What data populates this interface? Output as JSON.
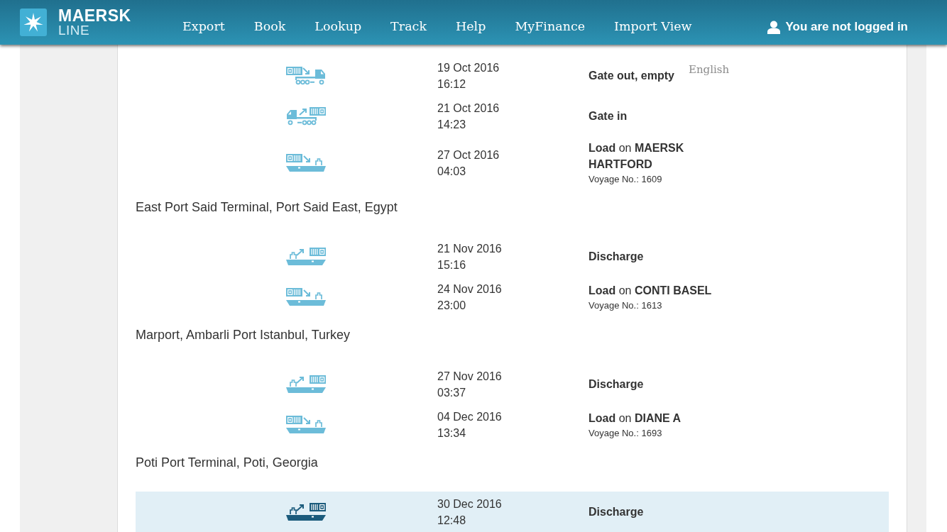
{
  "header": {
    "brand": {
      "name": "MAERSK",
      "subtitle": "LINE"
    },
    "nav": [
      "Export",
      "Book",
      "Lookup",
      "Track",
      "Help",
      "MyFinance",
      "Import View"
    ],
    "login_status": "You are not logged in"
  },
  "language_label": "English",
  "groups": [
    {
      "events": [
        {
          "kind": "gate_out",
          "date": "19 Oct 2016",
          "time": "16:12",
          "activity": "Gate out, empty",
          "current": false
        },
        {
          "kind": "gate_in",
          "date": "21 Oct 2016",
          "time": "14:23",
          "activity": "Gate in",
          "current": false
        },
        {
          "kind": "load",
          "date": "27 Oct 2016",
          "time": "04:03",
          "activity": "Load",
          "connector": "on",
          "vessel": "MAERSK HARTFORD",
          "voyage": "Voyage No.: 1609",
          "current": false
        }
      ]
    },
    {
      "location": "East Port Said Terminal, Port Said East, Egypt",
      "events": [
        {
          "kind": "discharge",
          "date": "21 Nov 2016",
          "time": "15:16",
          "activity": "Discharge",
          "current": false
        },
        {
          "kind": "load",
          "date": "24 Nov 2016",
          "time": "23:00",
          "activity": "Load",
          "connector": "on",
          "vessel": "CONTI BASEL",
          "voyage": "Voyage No.: 1613",
          "current": false
        }
      ]
    },
    {
      "location": "Marport, Ambarli Port Istanbul, Turkey",
      "events": [
        {
          "kind": "discharge",
          "date": "27 Nov 2016",
          "time": "03:37",
          "activity": "Discharge",
          "current": false
        },
        {
          "kind": "load",
          "date": "04 Dec 2016",
          "time": "13:34",
          "activity": "Load",
          "connector": "on",
          "vessel": "DIANE A",
          "voyage": "Voyage No.: 1693",
          "current": false
        }
      ]
    },
    {
      "location": "Poti Port Terminal, Poti, Georgia",
      "events": [
        {
          "kind": "discharge",
          "date": "30 Dec 2016",
          "time": "12:48",
          "activity": "Discharge",
          "current": true
        }
      ]
    }
  ]
}
